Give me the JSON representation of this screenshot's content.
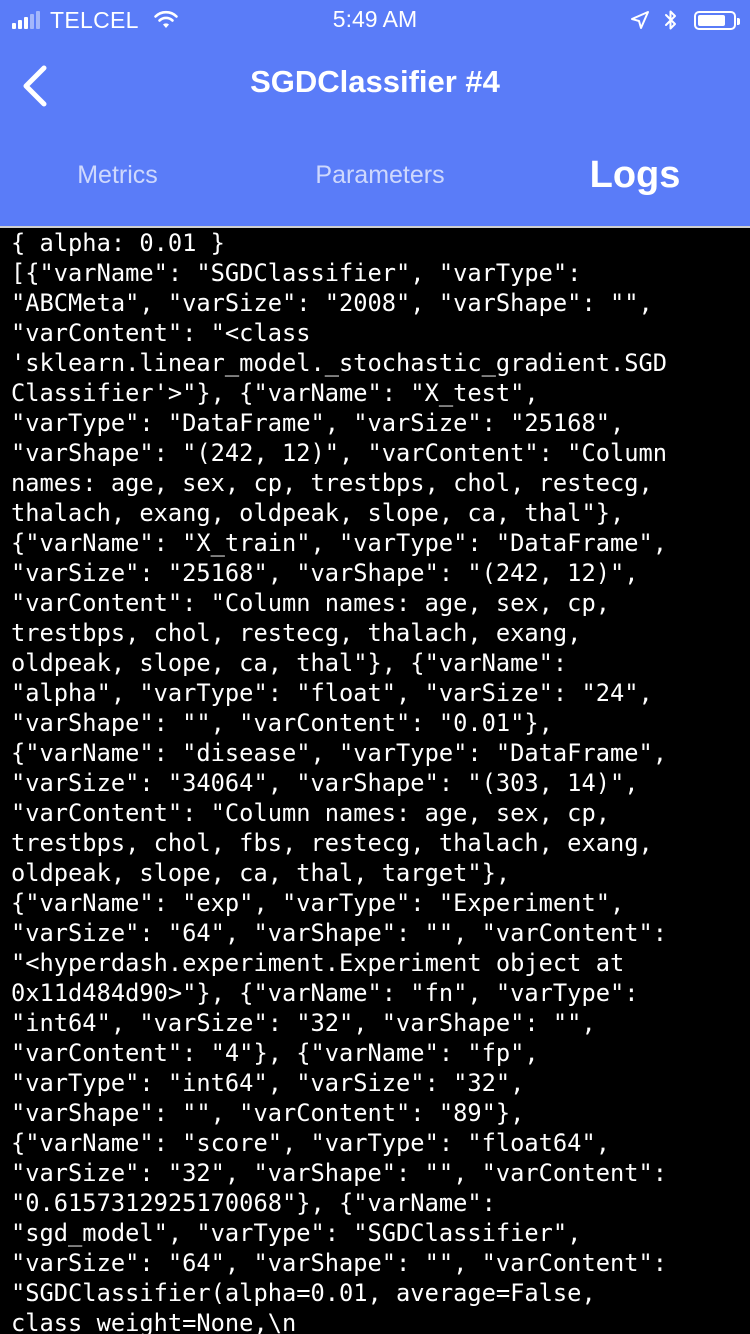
{
  "status_bar": {
    "carrier": "TELCEL",
    "time": "5:49 AM",
    "signal_strength": 3,
    "icons": [
      "wifi-icon",
      "location-arrow-icon",
      "bluetooth-icon",
      "battery-icon"
    ]
  },
  "nav": {
    "title": "SGDClassifier #4",
    "back_icon": "chevron-left-icon"
  },
  "tabs": [
    {
      "label": "Metrics",
      "active": false
    },
    {
      "label": "Parameters",
      "active": false
    },
    {
      "label": "Logs",
      "active": true
    }
  ],
  "colors": {
    "header_bg": "#5a7cf8",
    "log_bg": "#000000",
    "log_text": "#ffffff"
  },
  "logs": {
    "lines": [
      "{ alpha: 0.01 }",
      "[{\"varName\": \"SGDClassifier\", \"varType\":",
      "\"ABCMeta\", \"varSize\": \"2008\", \"varShape\": \"\",",
      "\"varContent\": \"<class",
      "'sklearn.linear_model._stochastic_gradient.SGD",
      "Classifier'>\"}, {\"varName\": \"X_test\",",
      "\"varType\": \"DataFrame\", \"varSize\": \"25168\",",
      "\"varShape\": \"(242, 12)\", \"varContent\": \"Column",
      "names: age, sex, cp, trestbps, chol, restecg,",
      "thalach, exang, oldpeak, slope, ca, thal\"},",
      "{\"varName\": \"X_train\", \"varType\": \"DataFrame\",",
      "\"varSize\": \"25168\", \"varShape\": \"(242, 12)\",",
      "\"varContent\": \"Column names: age, sex, cp,",
      "trestbps, chol, restecg, thalach, exang,",
      "oldpeak, slope, ca, thal\"}, {\"varName\":",
      "\"alpha\", \"varType\": \"float\", \"varSize\": \"24\",",
      "\"varShape\": \"\", \"varContent\": \"0.01\"},",
      "{\"varName\": \"disease\", \"varType\": \"DataFrame\",",
      "\"varSize\": \"34064\", \"varShape\": \"(303, 14)\",",
      "\"varContent\": \"Column names: age, sex, cp,",
      "trestbps, chol, fbs, restecg, thalach, exang,",
      "oldpeak, slope, ca, thal, target\"},",
      "{\"varName\": \"exp\", \"varType\": \"Experiment\",",
      "\"varSize\": \"64\", \"varShape\": \"\", \"varContent\":",
      "\"<hyperdash.experiment.Experiment object at",
      "0x11d484d90>\"}, {\"varName\": \"fn\", \"varType\":",
      "\"int64\", \"varSize\": \"32\", \"varShape\": \"\",",
      "\"varContent\": \"4\"}, {\"varName\": \"fp\",",
      "\"varType\": \"int64\", \"varSize\": \"32\",",
      "\"varShape\": \"\", \"varContent\": \"89\"},",
      "{\"varName\": \"score\", \"varType\": \"float64\",",
      "\"varSize\": \"32\", \"varShape\": \"\", \"varContent\":",
      "\"0.6157312925170068\"}, {\"varName\":",
      "\"sgd_model\", \"varType\": \"SGDClassifier\",",
      "\"varSize\": \"64\", \"varShape\": \"\", \"varContent\":",
      "\"SGDClassifier(alpha=0.01, average=False,",
      "class_weight=None,\\n"
    ]
  }
}
